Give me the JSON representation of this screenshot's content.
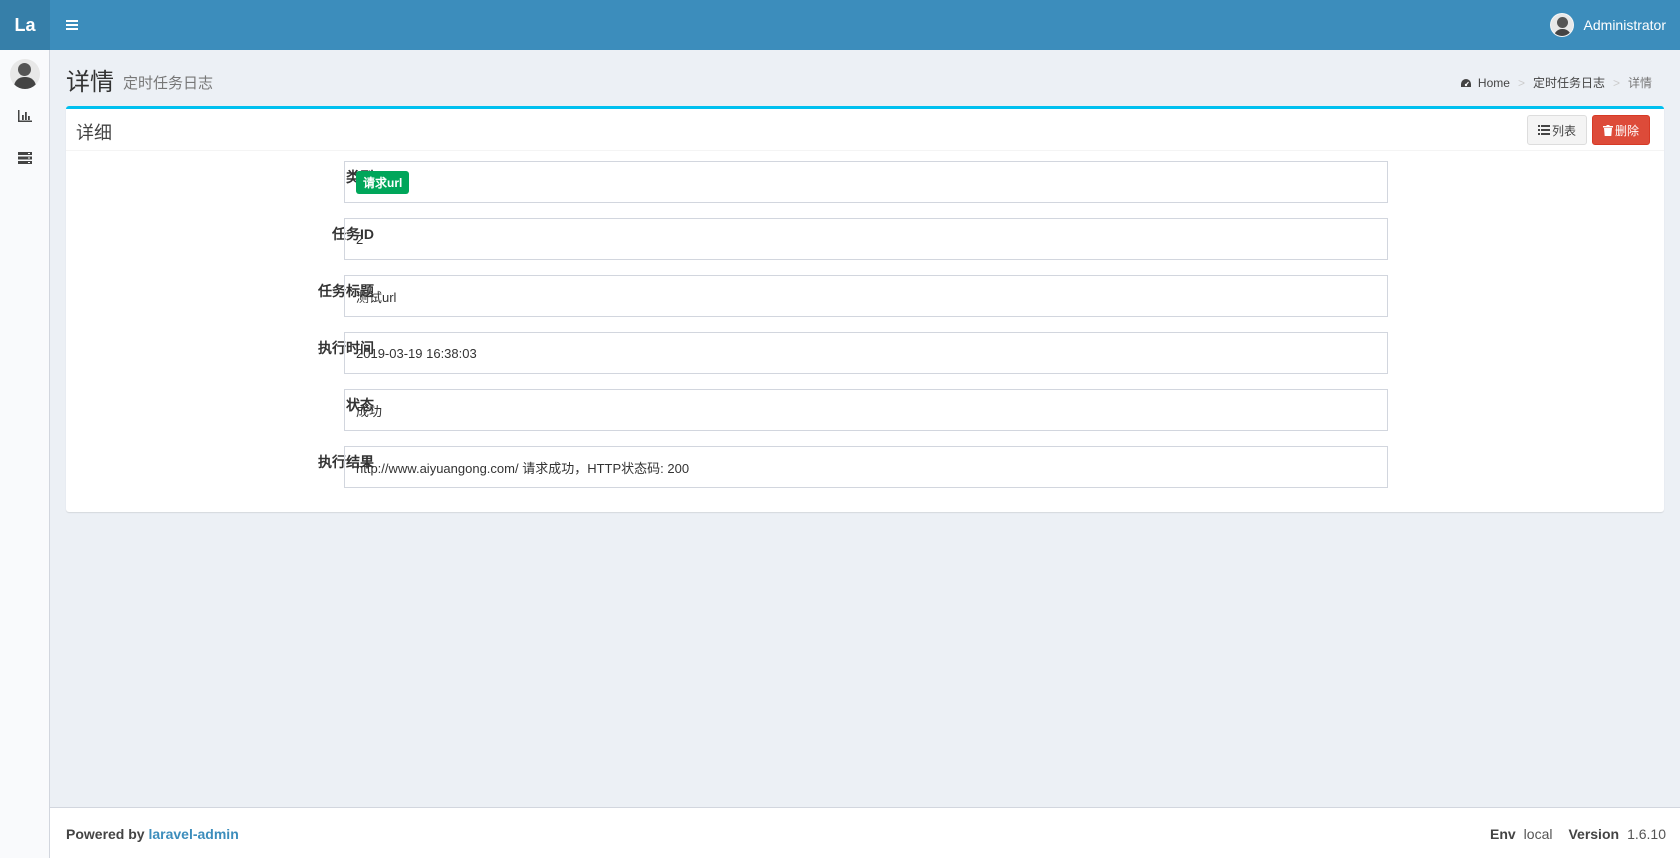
{
  "header": {
    "logo": "La",
    "username": "Administrator"
  },
  "page": {
    "title": "详情",
    "subtitle": "定时任务日志"
  },
  "breadcrumb": {
    "home": "Home",
    "section": "定时任务日志",
    "current": "详情"
  },
  "box": {
    "title": "详细",
    "list_button": "列表",
    "delete_button": "删除"
  },
  "fields": [
    {
      "label": "类型",
      "value": "请求url",
      "badge": true,
      "badge_color": "#00a65a"
    },
    {
      "label": "任务ID",
      "value": "2"
    },
    {
      "label": "任务标题",
      "value": "测试url"
    },
    {
      "label": "执行时间",
      "value": "2019-03-19 16:38:03"
    },
    {
      "label": "状态",
      "value": "成功"
    },
    {
      "label": "执行结果",
      "value": "http://www.aiyuangong.com/ 请求成功，HTTP状态码: 200"
    }
  ],
  "footer": {
    "powered_by": "Powered by",
    "link": "laravel-admin",
    "env_label": "Env",
    "env_value": "local",
    "version_label": "Version",
    "version_value": "1.6.10"
  },
  "colors": {
    "navbar": "#3c8dbc",
    "box_accent": "#00c0ef",
    "danger": "#dd4b39",
    "success": "#00a65a"
  }
}
